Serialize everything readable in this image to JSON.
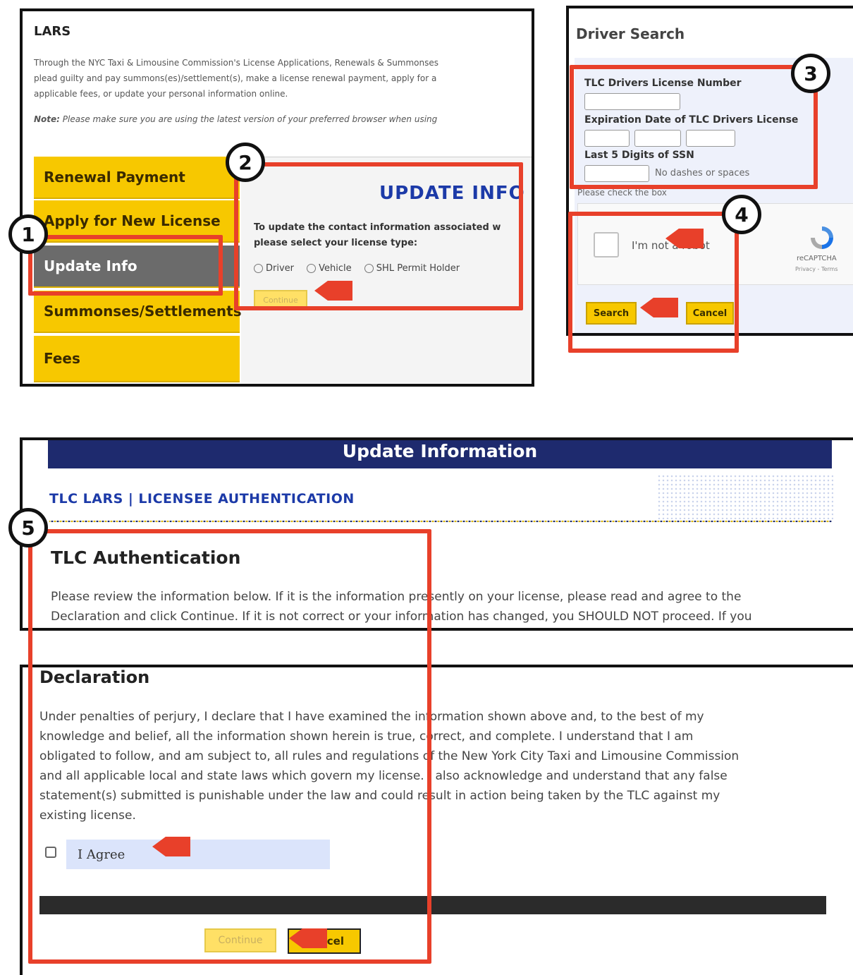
{
  "lars": {
    "title": "LARS",
    "intro_line1": "Through the NYC Taxi & Limousine Commission's License Applications, Renewals & Summonses",
    "intro_line2": "plead guilty and pay summons(es)/settlement(s), make a license renewal payment, apply for a",
    "intro_line3": "applicable fees, or update your personal information online.",
    "note_label": "Note:",
    "note_text": "Please make sure you are using the latest version of your preferred browser when using",
    "tabs": [
      {
        "label": "Renewal Payment"
      },
      {
        "label": "Apply for New License"
      },
      {
        "label": "Update Info"
      },
      {
        "label": "Summonses/Settlements"
      },
      {
        "label": "Fees"
      }
    ],
    "panel_title": "UPDATE INFO",
    "panel_instr_line1": "To update the contact information associated w",
    "panel_instr_line2": "please select your license type:",
    "radios": [
      "Driver",
      "Vehicle",
      "SHL Permit Holder"
    ],
    "continue_label": "Continue"
  },
  "driver_search": {
    "title": "Driver Search",
    "license_label": "TLC Drivers License Number",
    "expiration_label": "Expiration Date of TLC Drivers License",
    "ssn_label": "Last 5 Digits of SSN",
    "ssn_hint": "No dashes or spaces",
    "check_box_hint": "Please check the box",
    "captcha_label": "I'm not a robot",
    "captcha_brand": "reCAPTCHA",
    "captcha_links": "Privacy - Terms",
    "search_label": "Search",
    "cancel_label": "Cancel"
  },
  "update_info": {
    "banner": "Update Information",
    "subheader": "TLC LARS | LICENSEE AUTHENTICATION",
    "auth_title": "TLC Authentication",
    "auth_line1": "Please review the information below. If it is the information presently on your license, please read and agree to the",
    "auth_line2": "Declaration and click Continue. If it is not correct or your information has changed, you SHOULD NOT proceed. If you"
  },
  "declaration": {
    "title": "Declaration",
    "lines": [
      "Under penalties of perjury, I declare that I have examined the information shown above and, to the best of my",
      "knowledge and belief, all the information shown herein is true, correct, and complete. I understand that I am",
      "obligated to follow, and am subject to, all rules and regulations of the New York City Taxi and Limousine Commission",
      "and all applicable local and state laws which govern my license. I also acknowledge and understand that any false",
      "statement(s) submitted is punishable under the law and could result in action being taken by the TLC against my",
      "existing license."
    ],
    "agree_label": "I Agree",
    "continue_label": "Continue",
    "cancel_label": "Cancel"
  },
  "steps": [
    "1",
    "2",
    "3",
    "4",
    "5"
  ],
  "colors": {
    "highlight": "#e8402a",
    "tab_yellow": "#f7c800",
    "banner_navy": "#1e2a6e",
    "title_blue": "#1c3aa8"
  }
}
